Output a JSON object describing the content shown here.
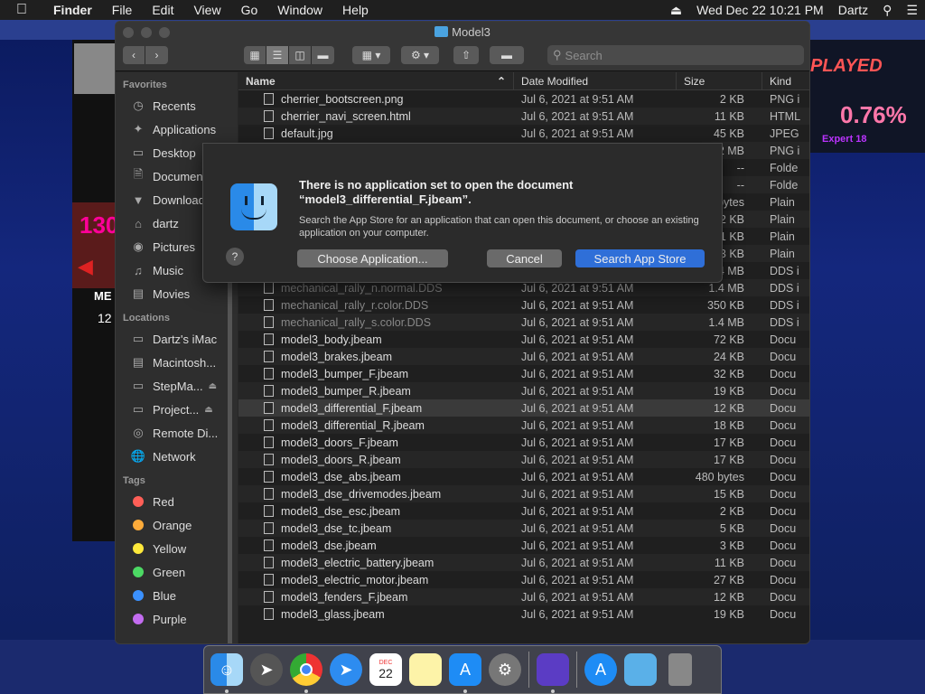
{
  "menubar": {
    "app": "Finder",
    "items": [
      "File",
      "Edit",
      "View",
      "Go",
      "Window",
      "Help"
    ],
    "datetime": "Wed Dec 22  10:21 PM",
    "user": "Dartz"
  },
  "background": {
    "played": "PLAYED",
    "percent": "0.76%",
    "expert": "Expert 18",
    "score": "130",
    "me": "ME",
    "twelve": "12"
  },
  "window": {
    "title": "Model3",
    "search_placeholder": "Search"
  },
  "sidebar": {
    "favorites_header": "Favorites",
    "favorites": [
      {
        "label": "Recents",
        "icon": "clock-icon"
      },
      {
        "label": "Applications",
        "icon": "applications-icon"
      },
      {
        "label": "Desktop",
        "icon": "desktop-icon"
      },
      {
        "label": "Documents",
        "icon": "document-icon"
      },
      {
        "label": "Downloads",
        "icon": "download-icon"
      },
      {
        "label": "dartz",
        "icon": "home-icon"
      },
      {
        "label": "Pictures",
        "icon": "camera-icon"
      },
      {
        "label": "Music",
        "icon": "music-icon"
      },
      {
        "label": "Movies",
        "icon": "film-icon"
      }
    ],
    "locations_header": "Locations",
    "locations": [
      {
        "label": "Dartz's iMac",
        "icon": "imac-icon"
      },
      {
        "label": "Macintosh...",
        "icon": "disk-icon"
      },
      {
        "label": "StepMa...",
        "icon": "drive-icon"
      },
      {
        "label": "Project...",
        "icon": "drive-icon"
      },
      {
        "label": "Remote Di...",
        "icon": "disc-icon"
      },
      {
        "label": "Network",
        "icon": "network-icon"
      }
    ],
    "tags_header": "Tags",
    "tags": [
      {
        "label": "Red",
        "color": "#ff5f57"
      },
      {
        "label": "Orange",
        "color": "#fdab3a"
      },
      {
        "label": "Yellow",
        "color": "#fee93b"
      },
      {
        "label": "Green",
        "color": "#4cd964"
      },
      {
        "label": "Blue",
        "color": "#3b91fe"
      },
      {
        "label": "Purple",
        "color": "#c36cf0"
      }
    ]
  },
  "list": {
    "headers": {
      "name": "Name",
      "date": "Date Modified",
      "size": "Size",
      "kind": "Kind"
    },
    "rows": [
      {
        "name": "cherrier_bootscreen.png",
        "date": "Jul 6, 2021 at 9:51 AM",
        "size": "2 KB",
        "kind": "PNG i"
      },
      {
        "name": "cherrier_navi_screen.html",
        "date": "Jul 6, 2021 at 9:51 AM",
        "size": "11 KB",
        "kind": "HTML"
      },
      {
        "name": "default.jpg",
        "date": "Jul 6, 2021 at 9:51 AM",
        "size": "45 KB",
        "kind": "JPEG"
      },
      {
        "name": "",
        "date": "",
        "size": "2 MB",
        "kind": "PNG i"
      },
      {
        "name": "",
        "date": "",
        "size": "--",
        "kind": "Folde"
      },
      {
        "name": "",
        "date": "",
        "size": "--",
        "kind": "Folde"
      },
      {
        "name": "",
        "date": "",
        "size": "bytes",
        "kind": "Plain"
      },
      {
        "name": "",
        "date": "",
        "size": "2 KB",
        "kind": "Plain"
      },
      {
        "name": "",
        "date": "",
        "size": "21 KB",
        "kind": "Plain"
      },
      {
        "name": "",
        "date": "",
        "size": "13 KB",
        "kind": "Plain"
      },
      {
        "name": "",
        "date": "",
        "size": "4 MB",
        "kind": "DDS i"
      },
      {
        "name": "mechanical_rally_n.normal.DDS",
        "date": "Jul 6, 2021 at 9:51 AM",
        "size": "1.4 MB",
        "kind": "DDS i"
      },
      {
        "name": "mechanical_rally_r.color.DDS",
        "date": "Jul 6, 2021 at 9:51 AM",
        "size": "350 KB",
        "kind": "DDS i"
      },
      {
        "name": "mechanical_rally_s.color.DDS",
        "date": "Jul 6, 2021 at 9:51 AM",
        "size": "1.4 MB",
        "kind": "DDS i"
      },
      {
        "name": "model3_body.jbeam",
        "date": "Jul 6, 2021 at 9:51 AM",
        "size": "72 KB",
        "kind": "Docu"
      },
      {
        "name": "model3_brakes.jbeam",
        "date": "Jul 6, 2021 at 9:51 AM",
        "size": "24 KB",
        "kind": "Docu"
      },
      {
        "name": "model3_bumper_F.jbeam",
        "date": "Jul 6, 2021 at 9:51 AM",
        "size": "32 KB",
        "kind": "Docu"
      },
      {
        "name": "model3_bumper_R.jbeam",
        "date": "Jul 6, 2021 at 9:51 AM",
        "size": "19 KB",
        "kind": "Docu"
      },
      {
        "name": "model3_differential_F.jbeam",
        "date": "Jul 6, 2021 at 9:51 AM",
        "size": "12 KB",
        "kind": "Docu"
      },
      {
        "name": "model3_differential_R.jbeam",
        "date": "Jul 6, 2021 at 9:51 AM",
        "size": "18 KB",
        "kind": "Docu"
      },
      {
        "name": "model3_doors_F.jbeam",
        "date": "Jul 6, 2021 at 9:51 AM",
        "size": "17 KB",
        "kind": "Docu"
      },
      {
        "name": "model3_doors_R.jbeam",
        "date": "Jul 6, 2021 at 9:51 AM",
        "size": "17 KB",
        "kind": "Docu"
      },
      {
        "name": "model3_dse_abs.jbeam",
        "date": "Jul 6, 2021 at 9:51 AM",
        "size": "480 bytes",
        "kind": "Docu"
      },
      {
        "name": "model3_dse_drivemodes.jbeam",
        "date": "Jul 6, 2021 at 9:51 AM",
        "size": "15 KB",
        "kind": "Docu"
      },
      {
        "name": "model3_dse_esc.jbeam",
        "date": "Jul 6, 2021 at 9:51 AM",
        "size": "2 KB",
        "kind": "Docu"
      },
      {
        "name": "model3_dse_tc.jbeam",
        "date": "Jul 6, 2021 at 9:51 AM",
        "size": "5 KB",
        "kind": "Docu"
      },
      {
        "name": "model3_dse.jbeam",
        "date": "Jul 6, 2021 at 9:51 AM",
        "size": "3 KB",
        "kind": "Docu"
      },
      {
        "name": "model3_electric_battery.jbeam",
        "date": "Jul 6, 2021 at 9:51 AM",
        "size": "11 KB",
        "kind": "Docu"
      },
      {
        "name": "model3_electric_motor.jbeam",
        "date": "Jul 6, 2021 at 9:51 AM",
        "size": "27 KB",
        "kind": "Docu"
      },
      {
        "name": "model3_fenders_F.jbeam",
        "date": "Jul 6, 2021 at 9:51 AM",
        "size": "12 KB",
        "kind": "Docu"
      },
      {
        "name": "model3_glass.jbeam",
        "date": "Jul 6, 2021 at 9:51 AM",
        "size": "19 KB",
        "kind": "Docu"
      }
    ],
    "highlighted_row": 18
  },
  "dialog": {
    "title": "There is no application set to open the document “model3_differential_F.jbeam”.",
    "body": "Search the App Store for an application that can open this document, or choose an existing application on your computer.",
    "help": "?",
    "choose_label": "Choose Application...",
    "cancel_label": "Cancel",
    "search_label": "Search App Store"
  },
  "dock": {
    "apps": [
      "finder-icon",
      "launchpad-icon",
      "chrome-icon",
      "safari-icon",
      "calendar-icon",
      "notes-icon",
      "app-store-icon",
      "system-preferences-icon",
      "game-icon",
      "app-store-folder-icon",
      "downloads-folder-icon",
      "trash-icon"
    ],
    "calendar_month": "DEC",
    "calendar_day": "22"
  }
}
